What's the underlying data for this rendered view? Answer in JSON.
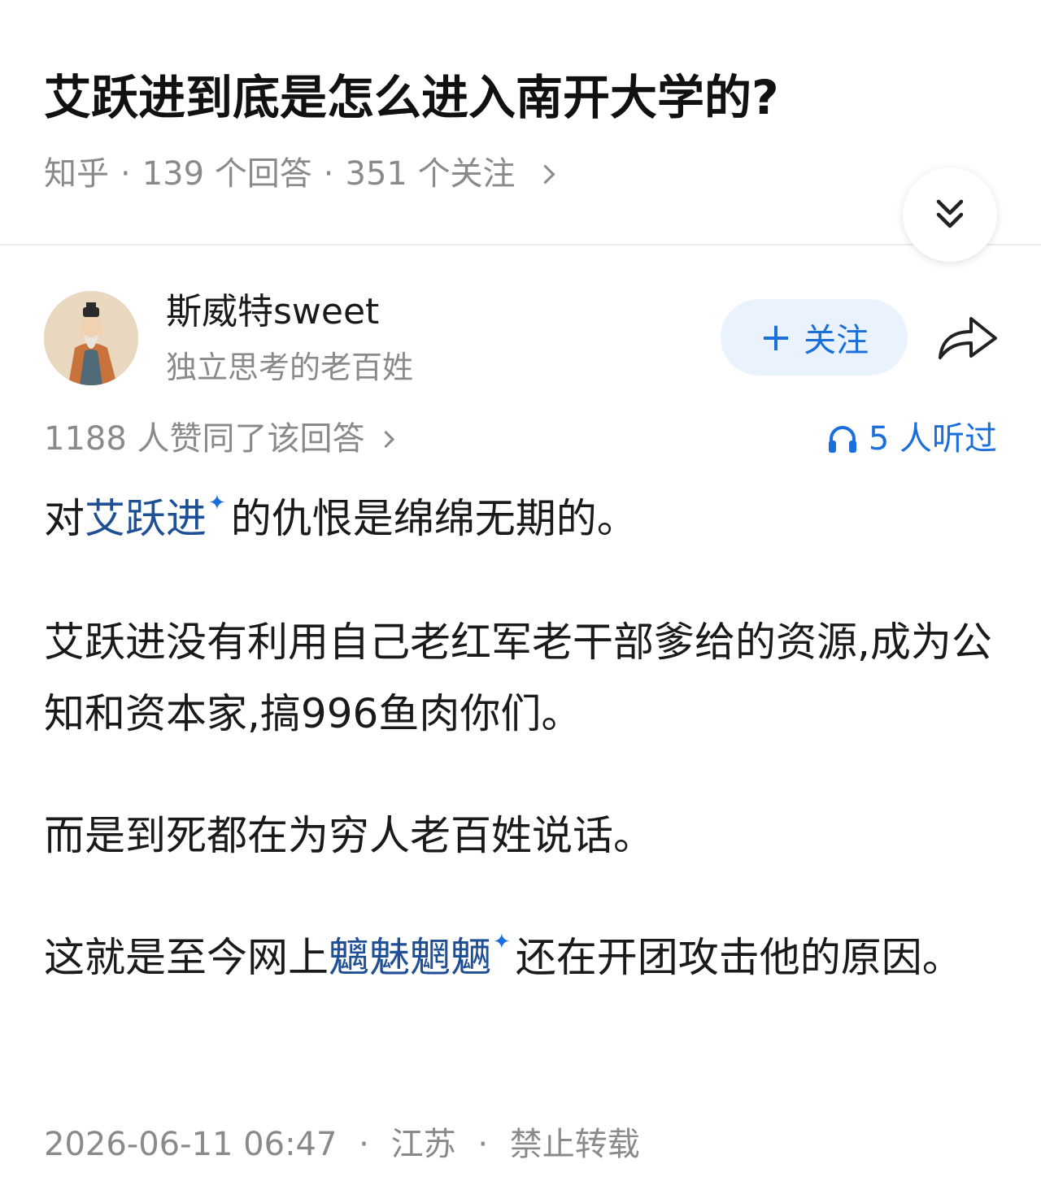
{
  "question": {
    "title": "艾跃进到底是怎么进入南开大学的?",
    "source": "知乎",
    "answers": "139 个回答",
    "followers": "351 个关注",
    "separator": "·"
  },
  "author": {
    "name": "斯威特sweet",
    "bio": "独立思考的老百姓",
    "follow_plus": "+",
    "follow_label": "关注"
  },
  "stats": {
    "votes": "1188 人赞同了该回答",
    "listened": "5 人听过"
  },
  "content": {
    "p1_pre": "对",
    "p1_link": "艾跃进",
    "p1_post": "的仇恨是绵绵无期的。",
    "p2": "艾跃进没有利用自己老红军老干部爹给的资源,成为公知和资本家,搞996鱼肉你们。",
    "p3": "而是到死都在为穷人老百姓说话。",
    "p4_pre": "这就是至今网上",
    "p4_link": "魑魅魍魉",
    "p4_post": "还在开团攻击他的原因。",
    "spark_glyph": "✦"
  },
  "footer": {
    "datetime": "2026-06-11 06:47",
    "location": "江苏",
    "copyright": "禁止转载",
    "separator": "·"
  },
  "colors": {
    "accent": "#1a6fdc",
    "link": "#1f4f94",
    "muted": "#8a8a8a",
    "follow_bg": "#eaf3fd"
  },
  "icons": {
    "collapse": "double-chevron-down-icon",
    "share": "share-arrow-icon",
    "listen": "headphones-icon",
    "spark": "sparkle-icon"
  }
}
